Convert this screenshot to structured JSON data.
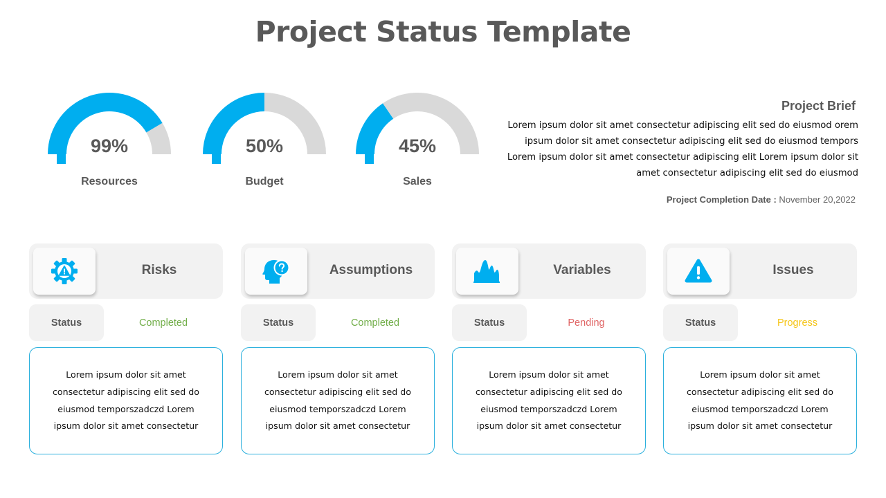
{
  "title": "Project Status Template",
  "colors": {
    "accent": "#00aeef",
    "track": "#d9d9d9",
    "completed": "#70ad47",
    "pending": "#e06666",
    "progress": "#f5c518",
    "card_border": "#2bb0dd"
  },
  "gauges": [
    {
      "label": "Resources",
      "value_text": "99%",
      "fill_fraction": 0.83
    },
    {
      "label": "Budget",
      "value_text": "50%",
      "fill_fraction": 0.5
    },
    {
      "label": "Sales",
      "value_text": "45%",
      "fill_fraction": 0.31
    }
  ],
  "brief": {
    "title": "Project Brief",
    "lines": [
      "Lorem ipsum dolor sit amet consectetur adipiscing elit sed do eiusmod orem",
      "ipsum dolor sit amet consectetur adipiscing elit sed do eiusmod tempors",
      "Lorem ipsum dolor sit amet consectetur adipiscing elit  Lorem ipsum dolor sit",
      "amet consectetur adipiscing elit sed do eiusmod"
    ],
    "date_label": "Project  Completion Date :",
    "date_value": " November 20,2022"
  },
  "cards": [
    {
      "title": "Risks",
      "icon": "gear-warning-icon",
      "status_label": "Status",
      "status": "Completed",
      "status_color": "#70ad47",
      "description": "Lorem ipsum dolor sit amet consectetur adipiscing elit sed do eiusmod temporszadczd Lorem ipsum dolor sit amet consectetur"
    },
    {
      "title": "Assumptions",
      "icon": "head-question-icon",
      "status_label": "Status",
      "status": "Completed",
      "status_color": "#70ad47",
      "description": "Lorem ipsum dolor sit amet consectetur adipiscing elit sed do eiusmod temporszadczd Lorem ipsum dolor sit amet consectetur"
    },
    {
      "title": "Variables",
      "icon": "area-chart-icon",
      "status_label": "Status",
      "status": "Pending",
      "status_color": "#e06666",
      "description": "Lorem ipsum dolor sit amet consectetur adipiscing elit sed do eiusmod temporszadczd Lorem ipsum dolor sit amet consectetur"
    },
    {
      "title": "Issues",
      "icon": "warning-triangle-icon",
      "status_label": "Status",
      "status": "Progress",
      "status_color": "#f5c518",
      "description": "Lorem ipsum dolor sit amet consectetur adipiscing elit sed do eiusmod temporszadczd Lorem ipsum dolor sit amet consectetur"
    }
  ]
}
